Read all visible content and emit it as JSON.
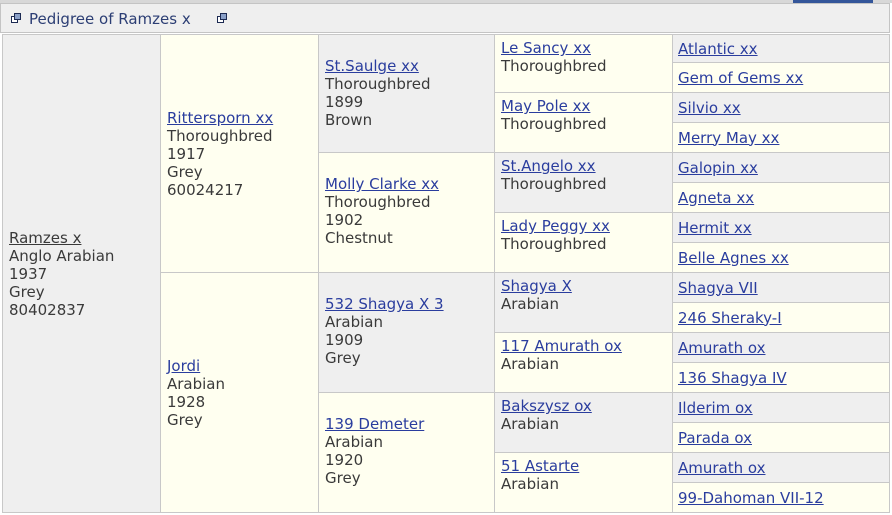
{
  "header": {
    "title": "Pedigree of Ramzes x"
  },
  "subject": {
    "name": "Ramzes x",
    "breed": "Anglo Arabian",
    "year": "1937",
    "color": "Grey",
    "id": "80402837"
  },
  "sire": {
    "name": "Rittersporn xx",
    "breed": "Thoroughbred",
    "year": "1917",
    "color": "Grey",
    "id": "60024217"
  },
  "dam": {
    "name": "Jordi",
    "breed": "Arabian",
    "year": "1928",
    "color": "Grey"
  },
  "gen3": [
    {
      "name": "St.Saulge xx",
      "breed": "Thoroughbred",
      "year": "1899",
      "color": "Brown"
    },
    {
      "name": "Molly Clarke xx",
      "breed": "Thoroughbred",
      "year": "1902",
      "color": "Chestnut"
    },
    {
      "name": "532 Shagya X 3",
      "breed": "Arabian",
      "year": "1909",
      "color": "Grey"
    },
    {
      "name": "139 Demeter",
      "breed": "Arabian",
      "year": "1920",
      "color": "Grey"
    }
  ],
  "gen4": [
    {
      "name": "Le Sancy xx",
      "breed": "Thoroughbred"
    },
    {
      "name": "May Pole xx",
      "breed": "Thoroughbred"
    },
    {
      "name": "St.Angelo xx",
      "breed": "Thoroughbred"
    },
    {
      "name": "Lady Peggy xx",
      "breed": "Thoroughbred"
    },
    {
      "name": "Shagya X",
      "breed": "Arabian"
    },
    {
      "name": "117 Amurath ox",
      "breed": "Arabian"
    },
    {
      "name": "Bakszysz ox",
      "breed": "Arabian"
    },
    {
      "name": "51 Astarte",
      "breed": "Arabian"
    }
  ],
  "gen5": [
    "Atlantic xx",
    "Gem of Gems xx",
    "Silvio xx",
    "Merry May xx",
    "Galopin xx",
    "Agneta xx",
    "Hermit xx",
    "Belle Agnes xx",
    "Shagya VII",
    "246 Sheraky-I ",
    "Amurath ox",
    "136 Shagya IV",
    "Ilderim ox",
    "Parada ox",
    "Amurath ox",
    "99-Dahoman VII-12"
  ]
}
